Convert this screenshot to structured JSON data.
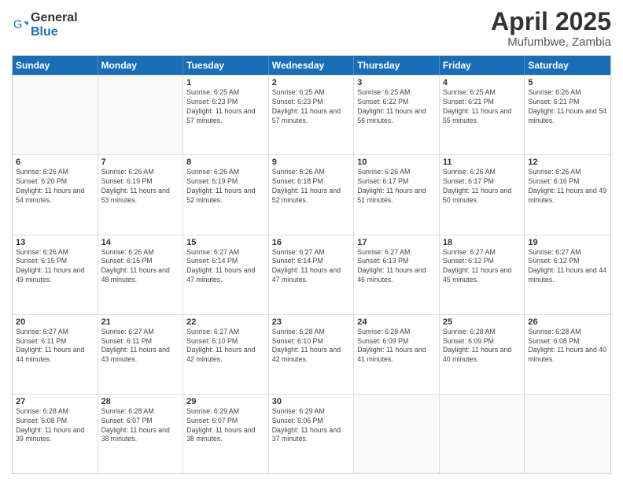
{
  "header": {
    "logo_general": "General",
    "logo_blue": "Blue",
    "title": "April 2025",
    "subtitle": "Mufumbwe, Zambia"
  },
  "days_of_week": [
    "Sunday",
    "Monday",
    "Tuesday",
    "Wednesday",
    "Thursday",
    "Friday",
    "Saturday"
  ],
  "weeks": [
    [
      {
        "day": "",
        "sunrise": "",
        "sunset": "",
        "daylight": "",
        "empty": true
      },
      {
        "day": "",
        "sunrise": "",
        "sunset": "",
        "daylight": "",
        "empty": true
      },
      {
        "day": "1",
        "sunrise": "Sunrise: 6:25 AM",
        "sunset": "Sunset: 6:23 PM",
        "daylight": "Daylight: 11 hours and 57 minutes.",
        "empty": false
      },
      {
        "day": "2",
        "sunrise": "Sunrise: 6:25 AM",
        "sunset": "Sunset: 6:23 PM",
        "daylight": "Daylight: 11 hours and 57 minutes.",
        "empty": false
      },
      {
        "day": "3",
        "sunrise": "Sunrise: 6:25 AM",
        "sunset": "Sunset: 6:22 PM",
        "daylight": "Daylight: 11 hours and 56 minutes.",
        "empty": false
      },
      {
        "day": "4",
        "sunrise": "Sunrise: 6:25 AM",
        "sunset": "Sunset: 6:21 PM",
        "daylight": "Daylight: 11 hours and 55 minutes.",
        "empty": false
      },
      {
        "day": "5",
        "sunrise": "Sunrise: 6:26 AM",
        "sunset": "Sunset: 6:21 PM",
        "daylight": "Daylight: 11 hours and 54 minutes.",
        "empty": false
      }
    ],
    [
      {
        "day": "6",
        "sunrise": "Sunrise: 6:26 AM",
        "sunset": "Sunset: 6:20 PM",
        "daylight": "Daylight: 11 hours and 54 minutes.",
        "empty": false
      },
      {
        "day": "7",
        "sunrise": "Sunrise: 6:26 AM",
        "sunset": "Sunset: 6:19 PM",
        "daylight": "Daylight: 11 hours and 53 minutes.",
        "empty": false
      },
      {
        "day": "8",
        "sunrise": "Sunrise: 6:26 AM",
        "sunset": "Sunset: 6:19 PM",
        "daylight": "Daylight: 11 hours and 52 minutes.",
        "empty": false
      },
      {
        "day": "9",
        "sunrise": "Sunrise: 6:26 AM",
        "sunset": "Sunset: 6:18 PM",
        "daylight": "Daylight: 11 hours and 52 minutes.",
        "empty": false
      },
      {
        "day": "10",
        "sunrise": "Sunrise: 6:26 AM",
        "sunset": "Sunset: 6:17 PM",
        "daylight": "Daylight: 11 hours and 51 minutes.",
        "empty": false
      },
      {
        "day": "11",
        "sunrise": "Sunrise: 6:26 AM",
        "sunset": "Sunset: 6:17 PM",
        "daylight": "Daylight: 11 hours and 50 minutes.",
        "empty": false
      },
      {
        "day": "12",
        "sunrise": "Sunrise: 6:26 AM",
        "sunset": "Sunset: 6:16 PM",
        "daylight": "Daylight: 11 hours and 49 minutes.",
        "empty": false
      }
    ],
    [
      {
        "day": "13",
        "sunrise": "Sunrise: 6:26 AM",
        "sunset": "Sunset: 6:15 PM",
        "daylight": "Daylight: 11 hours and 49 minutes.",
        "empty": false
      },
      {
        "day": "14",
        "sunrise": "Sunrise: 6:26 AM",
        "sunset": "Sunset: 6:15 PM",
        "daylight": "Daylight: 11 hours and 48 minutes.",
        "empty": false
      },
      {
        "day": "15",
        "sunrise": "Sunrise: 6:27 AM",
        "sunset": "Sunset: 6:14 PM",
        "daylight": "Daylight: 11 hours and 47 minutes.",
        "empty": false
      },
      {
        "day": "16",
        "sunrise": "Sunrise: 6:27 AM",
        "sunset": "Sunset: 6:14 PM",
        "daylight": "Daylight: 11 hours and 47 minutes.",
        "empty": false
      },
      {
        "day": "17",
        "sunrise": "Sunrise: 6:27 AM",
        "sunset": "Sunset: 6:13 PM",
        "daylight": "Daylight: 11 hours and 46 minutes.",
        "empty": false
      },
      {
        "day": "18",
        "sunrise": "Sunrise: 6:27 AM",
        "sunset": "Sunset: 6:12 PM",
        "daylight": "Daylight: 11 hours and 45 minutes.",
        "empty": false
      },
      {
        "day": "19",
        "sunrise": "Sunrise: 6:27 AM",
        "sunset": "Sunset: 6:12 PM",
        "daylight": "Daylight: 11 hours and 44 minutes.",
        "empty": false
      }
    ],
    [
      {
        "day": "20",
        "sunrise": "Sunrise: 6:27 AM",
        "sunset": "Sunset: 6:11 PM",
        "daylight": "Daylight: 11 hours and 44 minutes.",
        "empty": false
      },
      {
        "day": "21",
        "sunrise": "Sunrise: 6:27 AM",
        "sunset": "Sunset: 6:11 PM",
        "daylight": "Daylight: 11 hours and 43 minutes.",
        "empty": false
      },
      {
        "day": "22",
        "sunrise": "Sunrise: 6:27 AM",
        "sunset": "Sunset: 6:10 PM",
        "daylight": "Daylight: 11 hours and 42 minutes.",
        "empty": false
      },
      {
        "day": "23",
        "sunrise": "Sunrise: 6:28 AM",
        "sunset": "Sunset: 6:10 PM",
        "daylight": "Daylight: 11 hours and 42 minutes.",
        "empty": false
      },
      {
        "day": "24",
        "sunrise": "Sunrise: 6:28 AM",
        "sunset": "Sunset: 6:09 PM",
        "daylight": "Daylight: 11 hours and 41 minutes.",
        "empty": false
      },
      {
        "day": "25",
        "sunrise": "Sunrise: 6:28 AM",
        "sunset": "Sunset: 6:09 PM",
        "daylight": "Daylight: 11 hours and 40 minutes.",
        "empty": false
      },
      {
        "day": "26",
        "sunrise": "Sunrise: 6:28 AM",
        "sunset": "Sunset: 6:08 PM",
        "daylight": "Daylight: 11 hours and 40 minutes.",
        "empty": false
      }
    ],
    [
      {
        "day": "27",
        "sunrise": "Sunrise: 6:28 AM",
        "sunset": "Sunset: 6:08 PM",
        "daylight": "Daylight: 11 hours and 39 minutes.",
        "empty": false
      },
      {
        "day": "28",
        "sunrise": "Sunrise: 6:28 AM",
        "sunset": "Sunset: 6:07 PM",
        "daylight": "Daylight: 11 hours and 38 minutes.",
        "empty": false
      },
      {
        "day": "29",
        "sunrise": "Sunrise: 6:29 AM",
        "sunset": "Sunset: 6:07 PM",
        "daylight": "Daylight: 11 hours and 38 minutes.",
        "empty": false
      },
      {
        "day": "30",
        "sunrise": "Sunrise: 6:29 AM",
        "sunset": "Sunset: 6:06 PM",
        "daylight": "Daylight: 11 hours and 37 minutes.",
        "empty": false
      },
      {
        "day": "",
        "sunrise": "",
        "sunset": "",
        "daylight": "",
        "empty": true
      },
      {
        "day": "",
        "sunrise": "",
        "sunset": "",
        "daylight": "",
        "empty": true
      },
      {
        "day": "",
        "sunrise": "",
        "sunset": "",
        "daylight": "",
        "empty": true
      }
    ]
  ]
}
